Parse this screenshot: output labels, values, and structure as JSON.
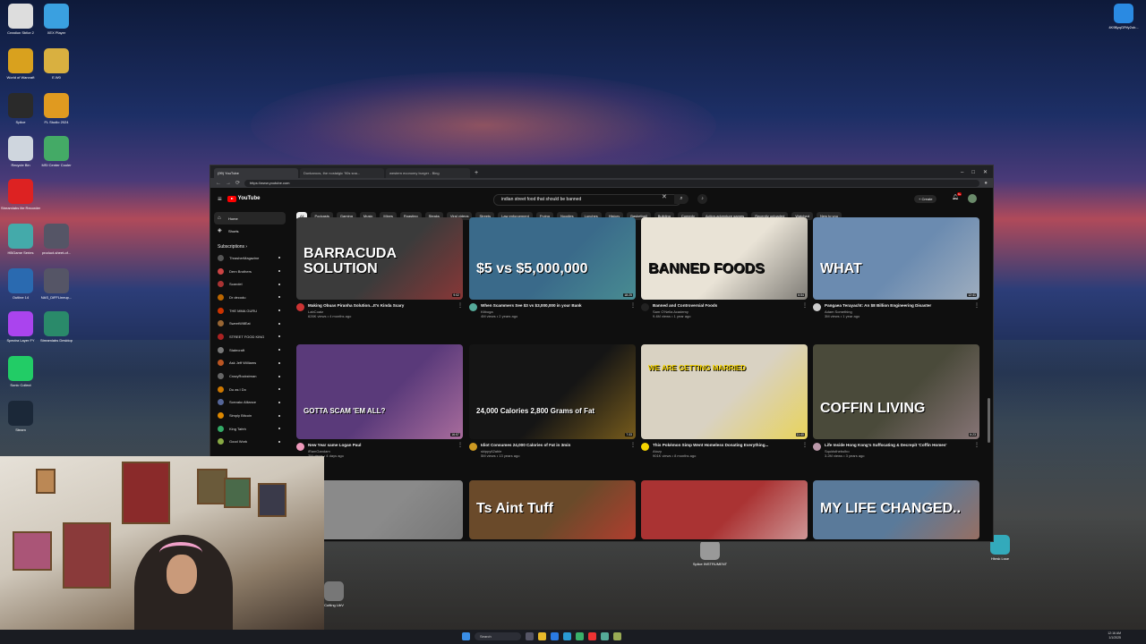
{
  "desktop": {
    "icons_left": [
      {
        "label": "Creation Strike 2"
      },
      {
        "label": "XEX Player"
      },
      {
        "label": "World of Warcraft"
      },
      {
        "label": "E.W0"
      },
      {
        "label": "Splice"
      },
      {
        "label": "FL Studio 2024"
      },
      {
        "label": "Recycle Bin"
      },
      {
        "label": "MSI Center Cooler"
      },
      {
        "label": "Streamlabs lite Recorder"
      },
      {
        "label": "HBGame Series"
      },
      {
        "label": "product-sheet-of..."
      },
      {
        "label": "Outline 14"
      },
      {
        "label": "NAS_DiFFLineup..."
      },
      {
        "label": "Spectra Layer FY"
      },
      {
        "label": "Streamlabs Desktop"
      },
      {
        "label": "Sonic Collect"
      },
      {
        "label": "Steam"
      }
    ],
    "icons_right": [
      {
        "label": "4K9$yqGFtfy2ob..."
      },
      {
        "label": "Splice INSTRUMENT"
      },
      {
        "label": "Hbrsk Lsse"
      },
      {
        "label": "Cutting LibV"
      }
    ]
  },
  "browser": {
    "tabs": [
      {
        "label": "(99) YouTube"
      },
      {
        "label": "Dunkaroos, the nostalgic '90s sna..."
      },
      {
        "label": "western economy burger - Bing"
      }
    ],
    "url": "https://www.youtube.com"
  },
  "youtube": {
    "logo": "YouTube",
    "search_value": "indian street food that should be banned",
    "create_label": "Create",
    "notif_count": "9+",
    "chips": [
      "All",
      "Podcasts",
      "Gaming",
      "Music",
      "Mixes",
      "Roasting",
      "Steaks",
      "Viral videos",
      "Streets",
      "Law enforcement",
      "Frying",
      "Noodles",
      "Lunches",
      "History",
      "Basketball",
      "Building",
      "Comedy",
      "Action-adventure games",
      "Recently uploaded",
      "Watched",
      "New to you"
    ],
    "nav": [
      {
        "label": "Home"
      },
      {
        "label": "Shorts"
      }
    ],
    "subs_heading": "Subscriptions",
    "subscriptions": [
      {
        "name": "ThrasherMagazine",
        "color": "#555"
      },
      {
        "name": "Dern Brothers",
        "color": "#c44"
      },
      {
        "name": "Scarolel",
        "color": "#a33"
      },
      {
        "name": "Dr decodu",
        "color": "#b60"
      },
      {
        "name": "THE MMA GURU",
        "color": "#c30"
      },
      {
        "name": "SweetWillEat",
        "color": "#963"
      },
      {
        "name": "STREET FOOD KING",
        "color": "#a22"
      },
      {
        "name": "Statecraft",
        "color": "#777"
      },
      {
        "name": "Ask Jeff Williams",
        "color": "#b52"
      },
      {
        "name": "CrazyRockstman",
        "color": "#666"
      },
      {
        "name": "Du as I Do",
        "color": "#c70"
      },
      {
        "name": "Scevakc Alliance",
        "color": "#569"
      },
      {
        "name": "Simply Bitcoin",
        "color": "#d80"
      },
      {
        "name": "King Tafeh",
        "color": "#3a6"
      },
      {
        "name": "Good Work",
        "color": "#8a4"
      }
    ],
    "videos": [
      {
        "thumb_text": "BARRACUDA SOLUTION",
        "duration": "9:02",
        "title": "Making Obuas Piranha Solution...It's Kinda Scary",
        "channel": "LabCoatz",
        "stats": "626K views • 4 months ago",
        "bg": "#3b3b3b",
        "accent": "#c33"
      },
      {
        "thumb_text": "$5 vs $5,000,000",
        "duration": "18:25",
        "title": "When Scammers See $3 vs $3,000,000 in your Bank",
        "channel": "Kitboga",
        "stats": "4M views • 2 years ago",
        "bg": "#3a6a8a",
        "accent": "#5a9"
      },
      {
        "thumb_text": "BANNED FOODS",
        "duration": "6:54",
        "title": "Banned and Controversial Foods",
        "channel": "Sam O'Nella Academy",
        "stats": "9.4M views • 1 year ago",
        "bg": "#e9e3d6",
        "accent": "#222"
      },
      {
        "thumb_text": "WHAT",
        "duration": "12:41",
        "title": "Pangaea Terayacht: An $8 Billion Engineering Disaster",
        "channel": "Adam Something",
        "stats": "3M views • 1 year ago",
        "bg": "#6b8bb0",
        "accent": "#ccc"
      },
      {
        "thumb_text": "GOTTA SCAM 'EM ALL?",
        "duration": "16:57",
        "title": "New Year same Logan Paul",
        "channel": "iRamGandam",
        "stats": "2M views • 4 days ago",
        "bg": "#5a3a7a",
        "accent": "#e9b"
      },
      {
        "thumb_text": "24,000 Calories 2,800 Grams of Fat",
        "duration": "7:33",
        "title": "Idiot Consumes 24,000 Calories of Fat in 3min",
        "channel": "skippy62able",
        "stats": "5M views • 13 years ago",
        "bg": "#151515",
        "accent": "#c92"
      },
      {
        "thumb_text": "WE ARE GETTING MARRIED",
        "duration": "11:40",
        "title": "This Pokémon Simp Went Homeless Donating Everything...",
        "channel": "Atozy",
        "stats": "901K views • 8 months ago",
        "bg": "#d9d2c2",
        "accent": "#f5d400"
      },
      {
        "thumb_text": "COFFIN LIVING",
        "duration": "6:23",
        "title": "Life Inside Hong Kong's Suffocating & Decrepit 'Coffin Homes'",
        "channel": "Squidsthebulbo",
        "stats": "3.2M views • 3 years ago",
        "bg": "#4a4a3a",
        "accent": "#b9a"
      },
      {
        "thumb_text": "",
        "duration": "",
        "title": "",
        "channel": "",
        "stats": "",
        "bg": "#8a8a8a",
        "accent": "#666"
      },
      {
        "thumb_text": "Ts Aint Tuff",
        "duration": "",
        "title": "",
        "channel": "",
        "stats": "",
        "bg": "#6a4a2a",
        "accent": "#e33"
      },
      {
        "thumb_text": "",
        "duration": "",
        "title": "",
        "channel": "",
        "stats": "",
        "bg": "#a33",
        "accent": "#eee"
      },
      {
        "thumb_text": "MY LIFE CHANGED..",
        "duration": "",
        "title": "",
        "channel": "",
        "stats": "",
        "bg": "#5a7a9a",
        "accent": "#c63"
      }
    ]
  },
  "taskbar": {
    "search_placeholder": "Search",
    "time": "12:16 AM",
    "date": "1/1/2025"
  }
}
